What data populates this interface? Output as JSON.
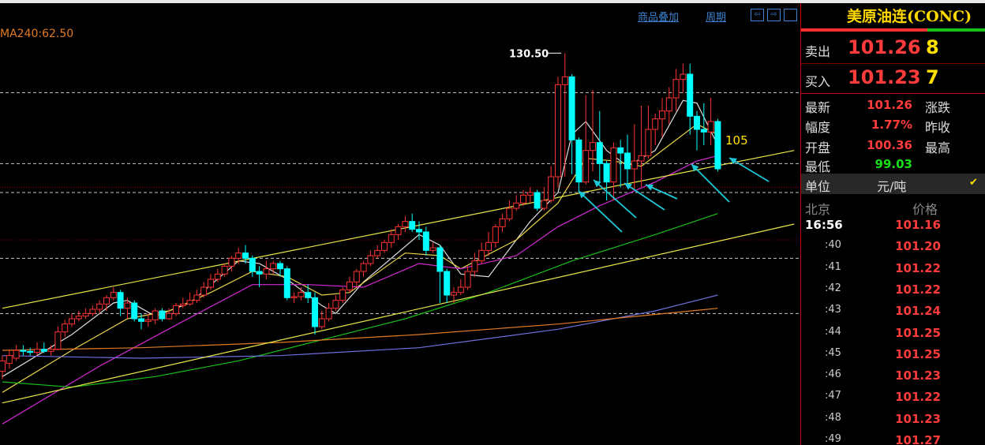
{
  "toolbar": {
    "overlay": "商品叠加",
    "period": "周期",
    "nav_left": "⇦",
    "nav_right": "⇨",
    "nav_box": ""
  },
  "ma_label": "MA240:62.50",
  "panel": {
    "title": "美原油连(CONC)",
    "sell_label": "卖出",
    "sell_price": "101.26",
    "sell_vol": "8",
    "buy_label": "买入",
    "buy_price": "101.23",
    "buy_vol": "7",
    "latest_label": "最新",
    "latest_value": "101.26",
    "change_label": "涨跌",
    "range_label": "幅度",
    "range_value": "1.77%",
    "prevclose_label": "昨收",
    "open_label": "开盘",
    "open_value": "100.36",
    "high_label": "最高",
    "low_label": "最低",
    "low_value": "99.03",
    "unit_label": "单位",
    "unit_value": "元/吨",
    "check": "✔",
    "col_beijing": "北京",
    "col_price": "价格",
    "ticks": [
      {
        "time": "16:56",
        "price": "101.16"
      },
      {
        "time": ":40",
        "price": "101.20"
      },
      {
        "time": ":41",
        "price": "101.22"
      },
      {
        "time": ":42",
        "price": "101.22"
      },
      {
        "time": ":43",
        "price": "101.24"
      },
      {
        "time": ":44",
        "price": "101.25"
      },
      {
        "time": ":45",
        "price": "101.25"
      },
      {
        "time": ":46",
        "price": "101.23"
      },
      {
        "time": ":47",
        "price": "101.22"
      },
      {
        "time": ":48",
        "price": "101.23"
      },
      {
        "time": ":49",
        "price": "101.27"
      }
    ]
  },
  "colors": {
    "up": "#ff3232",
    "down": "#00ffff",
    "ma5": "#dddddd",
    "ma10": "#e8d34a",
    "ma20": "#d42ad4",
    "ma60": "#18c018",
    "ma120": "#7070e0",
    "ma240": "#e07b25",
    "channel": "#e8e84a",
    "arrow": "#1fc8d8",
    "bg": "#000000"
  },
  "chart_data": {
    "type": "candlestick",
    "annotations": {
      "max_label": "130.50",
      "level_label": "105"
    },
    "ylim": [
      56,
      140
    ],
    "candles": [
      {
        "o": 70.0,
        "c": 72.0,
        "h": 73.0,
        "l": 68.5
      },
      {
        "o": 71.5,
        "c": 73.0,
        "h": 74.0,
        "l": 70.5
      },
      {
        "o": 72.5,
        "c": 74.0,
        "h": 75.0,
        "l": 72.0
      },
      {
        "o": 74.0,
        "c": 73.8,
        "h": 75.0,
        "l": 73.0
      },
      {
        "o": 73.8,
        "c": 73.6,
        "h": 74.5,
        "l": 73.0
      },
      {
        "o": 73.6,
        "c": 74.2,
        "h": 75.5,
        "l": 73.0
      },
      {
        "o": 74.2,
        "c": 73.8,
        "h": 75.5,
        "l": 73.5
      },
      {
        "o": 73.8,
        "c": 74.2,
        "h": 75.0,
        "l": 73.0
      },
      {
        "o": 74.2,
        "c": 77.5,
        "h": 78.5,
        "l": 74.0
      },
      {
        "o": 77.5,
        "c": 79.0,
        "h": 79.8,
        "l": 76.5
      },
      {
        "o": 79.0,
        "c": 80.0,
        "h": 81.0,
        "l": 78.5
      },
      {
        "o": 80.0,
        "c": 80.5,
        "h": 81.5,
        "l": 79.5
      },
      {
        "o": 80.5,
        "c": 81.0,
        "h": 82.0,
        "l": 80.0
      },
      {
        "o": 81.0,
        "c": 81.8,
        "h": 82.5,
        "l": 80.5
      },
      {
        "o": 81.8,
        "c": 82.8,
        "h": 83.5,
        "l": 81.0
      },
      {
        "o": 82.8,
        "c": 84.0,
        "h": 84.5,
        "l": 81.5
      },
      {
        "o": 84.0,
        "c": 85.0,
        "h": 86.0,
        "l": 83.5
      },
      {
        "o": 85.0,
        "c": 82.0,
        "h": 85.5,
        "l": 80.5
      },
      {
        "o": 82.0,
        "c": 83.0,
        "h": 84.0,
        "l": 80.0
      },
      {
        "o": 83.0,
        "c": 80.0,
        "h": 83.5,
        "l": 79.5
      },
      {
        "o": 80.0,
        "c": 79.5,
        "h": 81.0,
        "l": 78.0
      },
      {
        "o": 79.5,
        "c": 79.8,
        "h": 81.0,
        "l": 78.5
      },
      {
        "o": 79.8,
        "c": 81.5,
        "h": 82.0,
        "l": 79.0
      },
      {
        "o": 81.5,
        "c": 80.0,
        "h": 82.0,
        "l": 79.5
      },
      {
        "o": 80.0,
        "c": 81.0,
        "h": 82.0,
        "l": 79.8
      },
      {
        "o": 81.0,
        "c": 82.5,
        "h": 83.0,
        "l": 80.5
      },
      {
        "o": 82.5,
        "c": 82.8,
        "h": 84.0,
        "l": 82.0
      },
      {
        "o": 82.8,
        "c": 83.5,
        "h": 85.0,
        "l": 82.5
      },
      {
        "o": 83.5,
        "c": 84.5,
        "h": 85.5,
        "l": 83.0
      },
      {
        "o": 84.5,
        "c": 86.0,
        "h": 87.0,
        "l": 84.0
      },
      {
        "o": 86.0,
        "c": 87.5,
        "h": 88.5,
        "l": 85.5
      },
      {
        "o": 87.5,
        "c": 88.5,
        "h": 89.5,
        "l": 87.0
      },
      {
        "o": 88.5,
        "c": 90.0,
        "h": 90.5,
        "l": 88.0
      },
      {
        "o": 90.0,
        "c": 91.5,
        "h": 92.0,
        "l": 89.0
      },
      {
        "o": 91.5,
        "c": 92.5,
        "h": 93.5,
        "l": 90.5
      },
      {
        "o": 92.5,
        "c": 91.5,
        "h": 94.0,
        "l": 90.5
      },
      {
        "o": 91.5,
        "c": 89.0,
        "h": 92.0,
        "l": 88.0
      },
      {
        "o": 89.0,
        "c": 88.5,
        "h": 90.0,
        "l": 86.0
      },
      {
        "o": 88.5,
        "c": 89.5,
        "h": 91.0,
        "l": 87.5
      },
      {
        "o": 89.5,
        "c": 90.5,
        "h": 91.0,
        "l": 88.5
      },
      {
        "o": 90.5,
        "c": 89.5,
        "h": 91.0,
        "l": 88.0
      },
      {
        "o": 89.5,
        "c": 84.0,
        "h": 90.0,
        "l": 83.5
      },
      {
        "o": 84.0,
        "c": 84.2,
        "h": 85.0,
        "l": 83.0
      },
      {
        "o": 84.2,
        "c": 85.0,
        "h": 86.0,
        "l": 83.5
      },
      {
        "o": 85.0,
        "c": 84.0,
        "h": 86.5,
        "l": 83.0
      },
      {
        "o": 84.0,
        "c": 78.5,
        "h": 85.0,
        "l": 77.0
      },
      {
        "o": 78.5,
        "c": 80.0,
        "h": 81.5,
        "l": 78.0
      },
      {
        "o": 80.0,
        "c": 82.0,
        "h": 83.0,
        "l": 79.5
      },
      {
        "o": 82.0,
        "c": 83.5,
        "h": 84.5,
        "l": 81.5
      },
      {
        "o": 83.5,
        "c": 85.5,
        "h": 86.0,
        "l": 83.0
      },
      {
        "o": 85.5,
        "c": 87.0,
        "h": 88.0,
        "l": 85.0
      },
      {
        "o": 87.0,
        "c": 89.0,
        "h": 89.5,
        "l": 86.0
      },
      {
        "o": 89.0,
        "c": 90.5,
        "h": 91.0,
        "l": 88.0
      },
      {
        "o": 90.5,
        "c": 92.0,
        "h": 93.0,
        "l": 90.0
      },
      {
        "o": 92.0,
        "c": 93.0,
        "h": 94.0,
        "l": 91.5
      },
      {
        "o": 93.0,
        "c": 94.5,
        "h": 95.0,
        "l": 92.5
      },
      {
        "o": 94.5,
        "c": 96.0,
        "h": 97.0,
        "l": 93.5
      },
      {
        "o": 96.0,
        "c": 97.5,
        "h": 98.0,
        "l": 95.0
      },
      {
        "o": 97.5,
        "c": 98.5,
        "h": 99.5,
        "l": 96.5
      },
      {
        "o": 98.5,
        "c": 97.0,
        "h": 100.0,
        "l": 96.5
      },
      {
        "o": 97.0,
        "c": 96.5,
        "h": 98.5,
        "l": 95.0
      },
      {
        "o": 96.5,
        "c": 93.0,
        "h": 97.5,
        "l": 92.0
      },
      {
        "o": 93.0,
        "c": 93.5,
        "h": 94.5,
        "l": 92.5
      },
      {
        "o": 93.5,
        "c": 89.0,
        "h": 94.0,
        "l": 83.0
      },
      {
        "o": 89.0,
        "c": 84.5,
        "h": 89.5,
        "l": 83.0
      },
      {
        "o": 84.5,
        "c": 85.0,
        "h": 86.0,
        "l": 83.0
      },
      {
        "o": 85.0,
        "c": 86.0,
        "h": 87.5,
        "l": 84.5
      },
      {
        "o": 86.0,
        "c": 89.0,
        "h": 90.0,
        "l": 85.5
      },
      {
        "o": 89.0,
        "c": 91.0,
        "h": 92.5,
        "l": 88.0
      },
      {
        "o": 91.0,
        "c": 93.0,
        "h": 94.5,
        "l": 90.5
      },
      {
        "o": 93.0,
        "c": 94.5,
        "h": 96.5,
        "l": 92.0
      },
      {
        "o": 94.5,
        "c": 97.5,
        "h": 98.0,
        "l": 93.5
      },
      {
        "o": 97.5,
        "c": 99.0,
        "h": 100.0,
        "l": 96.5
      },
      {
        "o": 99.0,
        "c": 101.0,
        "h": 102.5,
        "l": 98.5
      },
      {
        "o": 101.0,
        "c": 102.0,
        "h": 103.5,
        "l": 100.5
      },
      {
        "o": 102.0,
        "c": 103.5,
        "h": 104.5,
        "l": 101.5
      },
      {
        "o": 103.5,
        "c": 104.0,
        "h": 105.0,
        "l": 102.0
      },
      {
        "o": 104.0,
        "c": 101.0,
        "h": 104.5,
        "l": 100.5
      },
      {
        "o": 101.0,
        "c": 102.5,
        "h": 105.0,
        "l": 100.5
      },
      {
        "o": 102.5,
        "c": 107.0,
        "h": 109.0,
        "l": 102.0
      },
      {
        "o": 107.0,
        "c": 124.5,
        "h": 126.0,
        "l": 105.0
      },
      {
        "o": 124.5,
        "c": 126.0,
        "h": 130.5,
        "l": 107.0
      },
      {
        "o": 126.0,
        "c": 114.0,
        "h": 126.5,
        "l": 107.5
      },
      {
        "o": 114.0,
        "c": 106.0,
        "h": 114.5,
        "l": 104.0
      },
      {
        "o": 106.0,
        "c": 112.0,
        "h": 122.5,
        "l": 105.5
      },
      {
        "o": 112.0,
        "c": 113.5,
        "h": 123.5,
        "l": 108.0
      },
      {
        "o": 113.5,
        "c": 109.5,
        "h": 119.5,
        "l": 106.0
      },
      {
        "o": 109.5,
        "c": 106.0,
        "h": 110.0,
        "l": 102.5
      },
      {
        "o": 106.0,
        "c": 112.5,
        "h": 113.5,
        "l": 102.5
      },
      {
        "o": 112.5,
        "c": 111.5,
        "h": 114.0,
        "l": 105.0
      },
      {
        "o": 111.5,
        "c": 108.5,
        "h": 115.0,
        "l": 105.0
      },
      {
        "o": 108.5,
        "c": 110.0,
        "h": 117.0,
        "l": 104.5
      },
      {
        "o": 110.0,
        "c": 111.0,
        "h": 120.5,
        "l": 105.0
      },
      {
        "o": 111.0,
        "c": 116.0,
        "h": 120.5,
        "l": 110.5
      },
      {
        "o": 116.0,
        "c": 118.0,
        "h": 119.0,
        "l": 113.0
      },
      {
        "o": 118.0,
        "c": 119.5,
        "h": 122.0,
        "l": 114.5
      },
      {
        "o": 119.5,
        "c": 122.0,
        "h": 124.0,
        "l": 117.0
      },
      {
        "o": 122.0,
        "c": 125.5,
        "h": 127.5,
        "l": 119.5
      },
      {
        "o": 125.5,
        "c": 126.5,
        "h": 128.5,
        "l": 123.0
      },
      {
        "o": 126.5,
        "c": 118.5,
        "h": 128.5,
        "l": 115.0
      },
      {
        "o": 118.5,
        "c": 116.0,
        "h": 119.5,
        "l": 112.0
      },
      {
        "o": 116.0,
        "c": 115.5,
        "h": 121.0,
        "l": 113.0
      },
      {
        "o": 115.5,
        "c": 117.5,
        "h": 122.0,
        "l": 113.0
      },
      {
        "o": 117.5,
        "c": 108.5,
        "h": 118.0,
        "l": 108.0
      }
    ],
    "ma": {
      "MA5": [
        [
          0,
          69
        ],
        [
          10,
          77
        ],
        [
          16,
          83
        ],
        [
          18,
          83.5
        ],
        [
          22,
          80.5
        ],
        [
          27,
          83
        ],
        [
          34,
          91
        ],
        [
          37,
          90.5
        ],
        [
          41,
          87.5
        ],
        [
          46,
          82.5
        ],
        [
          48,
          81
        ],
        [
          52,
          87
        ],
        [
          60,
          96
        ],
        [
          63,
          94
        ],
        [
          66,
          88.5
        ],
        [
          70,
          88
        ],
        [
          76,
          98.5
        ],
        [
          80,
          104
        ],
        [
          82,
          115
        ],
        [
          84,
          117.5
        ],
        [
          87,
          112
        ],
        [
          90,
          109
        ],
        [
          94,
          112
        ],
        [
          98,
          121.5
        ],
        [
          100,
          121
        ],
        [
          103,
          113
        ]
      ],
      "MA10": [
        [
          0,
          66
        ],
        [
          10,
          74
        ],
        [
          18,
          80
        ],
        [
          24,
          81.5
        ],
        [
          30,
          85
        ],
        [
          36,
          89
        ],
        [
          41,
          88
        ],
        [
          46,
          84.5
        ],
        [
          50,
          85
        ],
        [
          58,
          92.5
        ],
        [
          63,
          92
        ],
        [
          66,
          89.5
        ],
        [
          74,
          95
        ],
        [
          80,
          102
        ],
        [
          84,
          110.5
        ],
        [
          88,
          110
        ],
        [
          92,
          109
        ],
        [
          96,
          113
        ],
        [
          100,
          117
        ],
        [
          103,
          115
        ]
      ],
      "MA20": [
        [
          0,
          60
        ],
        [
          14,
          71
        ],
        [
          26,
          79.5
        ],
        [
          36,
          86.5
        ],
        [
          44,
          86.5
        ],
        [
          52,
          86
        ],
        [
          60,
          90.5
        ],
        [
          66,
          89.5
        ],
        [
          74,
          92
        ],
        [
          80,
          97.5
        ],
        [
          86,
          101.5
        ],
        [
          94,
          106
        ],
        [
          100,
          110
        ],
        [
          103,
          111
        ]
      ],
      "MA60": [
        [
          0,
          68
        ],
        [
          10,
          67
        ],
        [
          22,
          69
        ],
        [
          34,
          72
        ],
        [
          46,
          76
        ],
        [
          58,
          80
        ],
        [
          70,
          85
        ],
        [
          82,
          91
        ],
        [
          94,
          96
        ],
        [
          103,
          100
        ]
      ],
      "MA120": [
        [
          0,
          73
        ],
        [
          20,
          72.5
        ],
        [
          40,
          73
        ],
        [
          60,
          74.5
        ],
        [
          80,
          78
        ],
        [
          94,
          81.5
        ],
        [
          103,
          84.5
        ]
      ],
      "MA240": [
        [
          0,
          74
        ],
        [
          20,
          74.5
        ],
        [
          40,
          75.5
        ],
        [
          60,
          77
        ],
        [
          80,
          79
        ],
        [
          103,
          82
        ]
      ]
    },
    "channels": [
      {
        "from": [
          0,
          82
        ],
        "to": [
          114,
          112
        ]
      },
      {
        "from": [
          0,
          64
        ],
        "to": [
          114,
          98
        ]
      }
    ],
    "hlines": [
      123,
      109.5,
      104,
      91.5,
      81
    ]
  }
}
